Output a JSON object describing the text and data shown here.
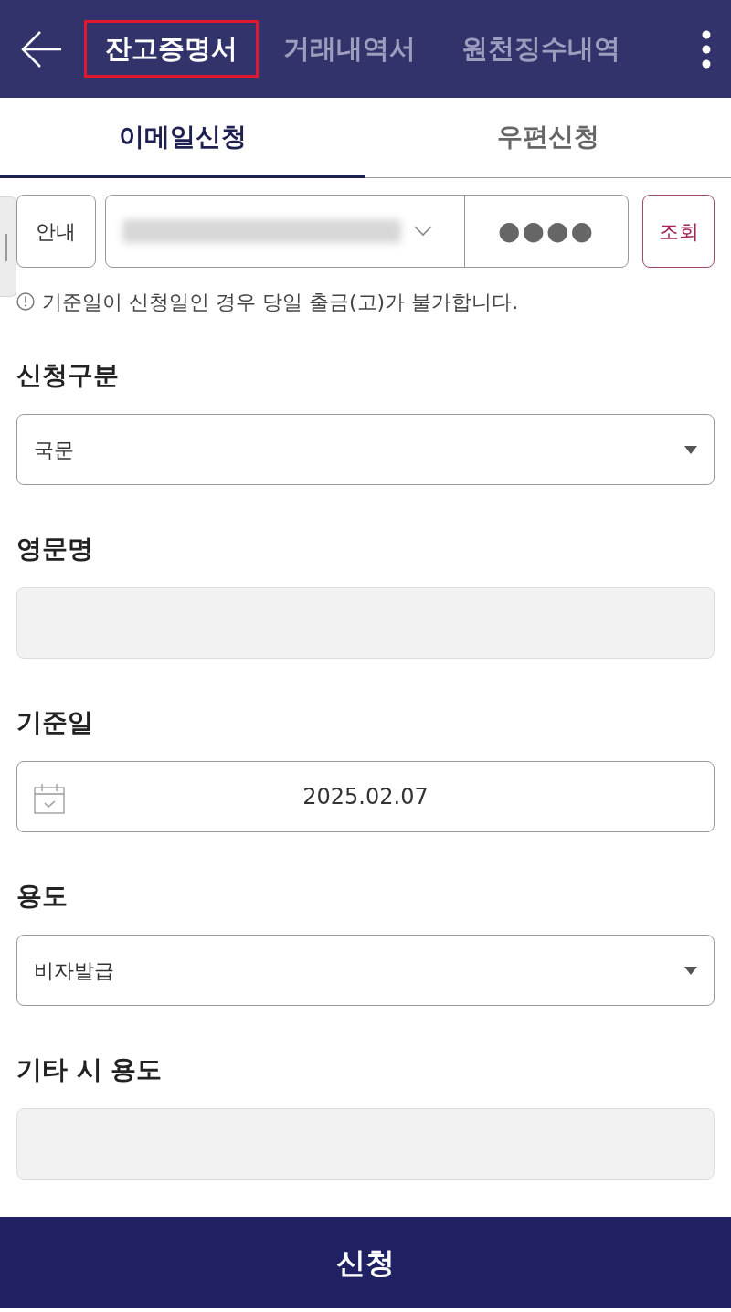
{
  "header": {
    "tabs": [
      {
        "label": "잔고증명서",
        "selected": true,
        "highlighted": true
      },
      {
        "label": "거래내역서",
        "selected": false,
        "highlighted": false
      },
      {
        "label": "원천징수내역",
        "selected": false,
        "highlighted": false
      }
    ]
  },
  "subtabs": [
    {
      "label": "이메일신청",
      "selected": true
    },
    {
      "label": "우편신청",
      "selected": false
    }
  ],
  "account_bar": {
    "guide_button": "안내",
    "password": "●●●●",
    "lookup_button": "조회"
  },
  "notice": "기준일이 신청일인 경우 당일 출금(고)가 불가합니다.",
  "form": [
    {
      "kind": "select",
      "label": "신청구분",
      "value": "국문",
      "disabled": false
    },
    {
      "kind": "text",
      "label": "영문명",
      "disabled": true
    },
    {
      "kind": "date",
      "label": "기준일",
      "value": "2025.02.07",
      "disabled": false
    },
    {
      "kind": "select",
      "label": "용도",
      "value": "비자발급",
      "disabled": false
    },
    {
      "kind": "text",
      "label": "기타 시 용도",
      "disabled": true
    }
  ],
  "submit_button": "신청"
}
